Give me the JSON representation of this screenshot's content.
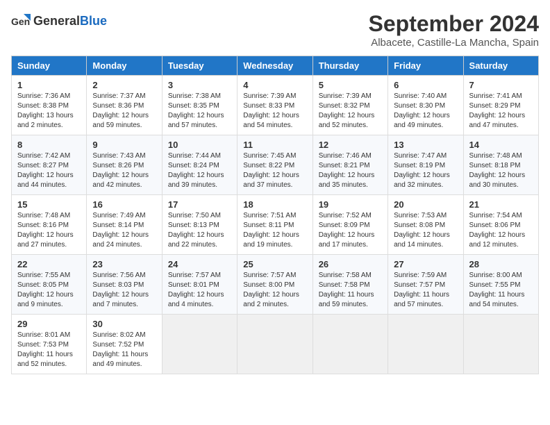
{
  "header": {
    "logo_general": "General",
    "logo_blue": "Blue",
    "title": "September 2024",
    "subtitle": "Albacete, Castille-La Mancha, Spain"
  },
  "columns": [
    "Sunday",
    "Monday",
    "Tuesday",
    "Wednesday",
    "Thursday",
    "Friday",
    "Saturday"
  ],
  "weeks": [
    [
      {
        "day": "1",
        "sunrise": "Sunrise: 7:36 AM",
        "sunset": "Sunset: 8:38 PM",
        "daylight": "Daylight: 13 hours and 2 minutes."
      },
      {
        "day": "2",
        "sunrise": "Sunrise: 7:37 AM",
        "sunset": "Sunset: 8:36 PM",
        "daylight": "Daylight: 12 hours and 59 minutes."
      },
      {
        "day": "3",
        "sunrise": "Sunrise: 7:38 AM",
        "sunset": "Sunset: 8:35 PM",
        "daylight": "Daylight: 12 hours and 57 minutes."
      },
      {
        "day": "4",
        "sunrise": "Sunrise: 7:39 AM",
        "sunset": "Sunset: 8:33 PM",
        "daylight": "Daylight: 12 hours and 54 minutes."
      },
      {
        "day": "5",
        "sunrise": "Sunrise: 7:39 AM",
        "sunset": "Sunset: 8:32 PM",
        "daylight": "Daylight: 12 hours and 52 minutes."
      },
      {
        "day": "6",
        "sunrise": "Sunrise: 7:40 AM",
        "sunset": "Sunset: 8:30 PM",
        "daylight": "Daylight: 12 hours and 49 minutes."
      },
      {
        "day": "7",
        "sunrise": "Sunrise: 7:41 AM",
        "sunset": "Sunset: 8:29 PM",
        "daylight": "Daylight: 12 hours and 47 minutes."
      }
    ],
    [
      {
        "day": "8",
        "sunrise": "Sunrise: 7:42 AM",
        "sunset": "Sunset: 8:27 PM",
        "daylight": "Daylight: 12 hours and 44 minutes."
      },
      {
        "day": "9",
        "sunrise": "Sunrise: 7:43 AM",
        "sunset": "Sunset: 8:26 PM",
        "daylight": "Daylight: 12 hours and 42 minutes."
      },
      {
        "day": "10",
        "sunrise": "Sunrise: 7:44 AM",
        "sunset": "Sunset: 8:24 PM",
        "daylight": "Daylight: 12 hours and 39 minutes."
      },
      {
        "day": "11",
        "sunrise": "Sunrise: 7:45 AM",
        "sunset": "Sunset: 8:22 PM",
        "daylight": "Daylight: 12 hours and 37 minutes."
      },
      {
        "day": "12",
        "sunrise": "Sunrise: 7:46 AM",
        "sunset": "Sunset: 8:21 PM",
        "daylight": "Daylight: 12 hours and 35 minutes."
      },
      {
        "day": "13",
        "sunrise": "Sunrise: 7:47 AM",
        "sunset": "Sunset: 8:19 PM",
        "daylight": "Daylight: 12 hours and 32 minutes."
      },
      {
        "day": "14",
        "sunrise": "Sunrise: 7:48 AM",
        "sunset": "Sunset: 8:18 PM",
        "daylight": "Daylight: 12 hours and 30 minutes."
      }
    ],
    [
      {
        "day": "15",
        "sunrise": "Sunrise: 7:48 AM",
        "sunset": "Sunset: 8:16 PM",
        "daylight": "Daylight: 12 hours and 27 minutes."
      },
      {
        "day": "16",
        "sunrise": "Sunrise: 7:49 AM",
        "sunset": "Sunset: 8:14 PM",
        "daylight": "Daylight: 12 hours and 24 minutes."
      },
      {
        "day": "17",
        "sunrise": "Sunrise: 7:50 AM",
        "sunset": "Sunset: 8:13 PM",
        "daylight": "Daylight: 12 hours and 22 minutes."
      },
      {
        "day": "18",
        "sunrise": "Sunrise: 7:51 AM",
        "sunset": "Sunset: 8:11 PM",
        "daylight": "Daylight: 12 hours and 19 minutes."
      },
      {
        "day": "19",
        "sunrise": "Sunrise: 7:52 AM",
        "sunset": "Sunset: 8:09 PM",
        "daylight": "Daylight: 12 hours and 17 minutes."
      },
      {
        "day": "20",
        "sunrise": "Sunrise: 7:53 AM",
        "sunset": "Sunset: 8:08 PM",
        "daylight": "Daylight: 12 hours and 14 minutes."
      },
      {
        "day": "21",
        "sunrise": "Sunrise: 7:54 AM",
        "sunset": "Sunset: 8:06 PM",
        "daylight": "Daylight: 12 hours and 12 minutes."
      }
    ],
    [
      {
        "day": "22",
        "sunrise": "Sunrise: 7:55 AM",
        "sunset": "Sunset: 8:05 PM",
        "daylight": "Daylight: 12 hours and 9 minutes."
      },
      {
        "day": "23",
        "sunrise": "Sunrise: 7:56 AM",
        "sunset": "Sunset: 8:03 PM",
        "daylight": "Daylight: 12 hours and 7 minutes."
      },
      {
        "day": "24",
        "sunrise": "Sunrise: 7:57 AM",
        "sunset": "Sunset: 8:01 PM",
        "daylight": "Daylight: 12 hours and 4 minutes."
      },
      {
        "day": "25",
        "sunrise": "Sunrise: 7:57 AM",
        "sunset": "Sunset: 8:00 PM",
        "daylight": "Daylight: 12 hours and 2 minutes."
      },
      {
        "day": "26",
        "sunrise": "Sunrise: 7:58 AM",
        "sunset": "Sunset: 7:58 PM",
        "daylight": "Daylight: 11 hours and 59 minutes."
      },
      {
        "day": "27",
        "sunrise": "Sunrise: 7:59 AM",
        "sunset": "Sunset: 7:57 PM",
        "daylight": "Daylight: 11 hours and 57 minutes."
      },
      {
        "day": "28",
        "sunrise": "Sunrise: 8:00 AM",
        "sunset": "Sunset: 7:55 PM",
        "daylight": "Daylight: 11 hours and 54 minutes."
      }
    ],
    [
      {
        "day": "29",
        "sunrise": "Sunrise: 8:01 AM",
        "sunset": "Sunset: 7:53 PM",
        "daylight": "Daylight: 11 hours and 52 minutes."
      },
      {
        "day": "30",
        "sunrise": "Sunrise: 8:02 AM",
        "sunset": "Sunset: 7:52 PM",
        "daylight": "Daylight: 11 hours and 49 minutes."
      },
      null,
      null,
      null,
      null,
      null
    ]
  ]
}
